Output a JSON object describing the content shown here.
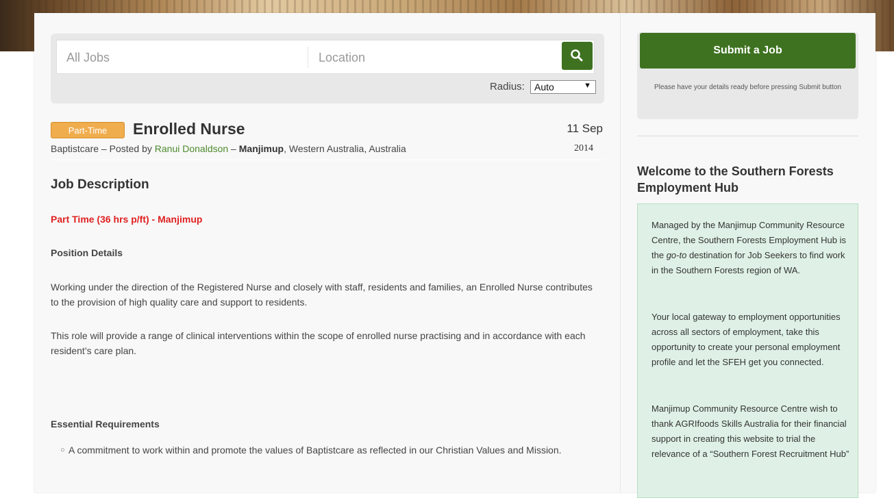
{
  "search": {
    "jobs_placeholder": "All Jobs",
    "location_placeholder": "Location",
    "radius_label": "Radius:",
    "radius_value": "Auto"
  },
  "job": {
    "badge": "Part-Time",
    "title": "Enrolled Nurse",
    "date_day_month": "11 Sep",
    "date_year": "2014",
    "company": "Baptistcare",
    "posted_by_prefix": " – Posted by ",
    "poster": "Ranui Donaldson",
    "separator": " – ",
    "location_town": "Manjimup",
    "location_rest": ", Western Australia, Australia"
  },
  "description": {
    "heading": "Job Description",
    "highlight": "Part Time (36 hrs p/ft) - Manjimup",
    "position_details_heading": "Position Details",
    "para1": "Working under the direction of the Registered Nurse and closely with staff, residents and families, an Enrolled Nurse contributes to the provision of high quality care and support to residents.",
    "para2": "This role will provide a range of clinical interventions within the scope of enrolled nurse practising and in accordance with each resident’s care plan.",
    "requirements_heading": "Essential Requirements",
    "bullets": [
      "A commitment to work within and promote the values of Baptistcare as reflected in our Christian Values and Mission."
    ]
  },
  "sidebar": {
    "submit_label": "Submit a Job",
    "submit_note": "Please have your details ready before pressing Submit button",
    "welcome_title": "Welcome to the Southern Forests Employment Hub",
    "welcome_p1_a": "Managed by the Manjimup Community Resource Centre, the Southern Forests Employment Hub is the ",
    "welcome_p1_em": "go-to",
    "welcome_p1_b": " destination for Job Seekers to find work in the Southern Forests region of WA.",
    "welcome_p2": "Your local gateway to employment opportunities across all sectors of employment, take this opportunity to create your personal employment profile and let the SFEH get you connected.",
    "welcome_p3": "Manjimup Community Resource Centre wish to thank AGRIfoods Skills Australia for their financial support in creating this website to trial the relevance of a “Southern Forest Recruitment Hub”"
  },
  "colors": {
    "accent_green": "#3e7220",
    "badge_orange": "#f0ad4e",
    "highlight_red": "#e02020",
    "link_green": "#4c8a2c",
    "welcome_bg": "#dff1e6"
  }
}
